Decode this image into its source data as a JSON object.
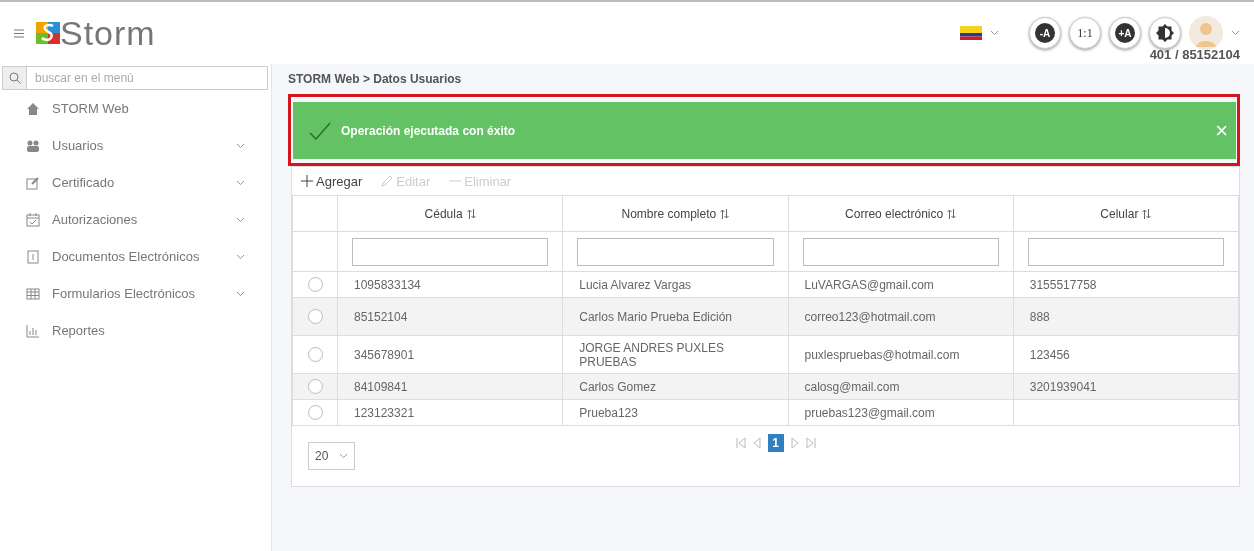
{
  "header": {
    "logo": "Storm",
    "view_buttons": [
      {
        "kind": "text",
        "label": "-A"
      },
      {
        "kind": "text",
        "label": "1:1"
      },
      {
        "kind": "text",
        "label": "+A"
      },
      {
        "kind": "contrast"
      }
    ],
    "user_code": "401 / 85152104"
  },
  "sidebar": {
    "search": {
      "placeholder": "buscar en el menú"
    },
    "items": [
      {
        "label": "STORM Web",
        "expandable": false
      },
      {
        "label": "Usuarios",
        "expandable": true
      },
      {
        "label": "Certificado",
        "expandable": true
      },
      {
        "label": "Autorizaciones",
        "expandable": true
      },
      {
        "label": "Documentos Electrónicos",
        "expandable": true
      },
      {
        "label": "Formularios Electrónicos",
        "expandable": true
      },
      {
        "label": "Reportes",
        "expandable": false
      }
    ]
  },
  "breadcrumb": "STORM Web > Datos Usuarios",
  "alert": {
    "message": "Operación ejecutada con éxito",
    "close": "×"
  },
  "toolbar": [
    {
      "label": "Agregar",
      "disabled": false
    },
    {
      "label": "Editar",
      "disabled": true
    },
    {
      "label": "Eliminar",
      "disabled": true
    }
  ],
  "table": {
    "columns": [
      "Cédula",
      "Nombre completo",
      "Correo electrónico",
      "Celular"
    ],
    "rows": [
      {
        "selected": false,
        "cells": [
          "1095833134",
          "Lucia Alvarez Vargas",
          "LuVARGAS@gmail.com",
          "3155517758"
        ]
      },
      {
        "selected": false,
        "cells": [
          "85152104",
          "Carlos Mario Prueba Edición",
          "correo123@hotmail.com",
          "888"
        ]
      },
      {
        "selected": false,
        "cells": [
          "345678901",
          "JORGE ANDRES PUXLES PRUEBAS",
          "puxlespruebas@hotmail.com",
          "123456"
        ]
      },
      {
        "selected": false,
        "cells": [
          "84109841",
          "Carlos Gomez",
          "calosg@mail.com",
          "3201939041"
        ]
      },
      {
        "selected": false,
        "cells": [
          "123123321",
          "Prueba123",
          "pruebas123@gmail.com",
          ""
        ]
      }
    ]
  },
  "pager": {
    "page_size": "20",
    "pages": [
      {
        "label": "1",
        "selected": true
      }
    ]
  }
}
